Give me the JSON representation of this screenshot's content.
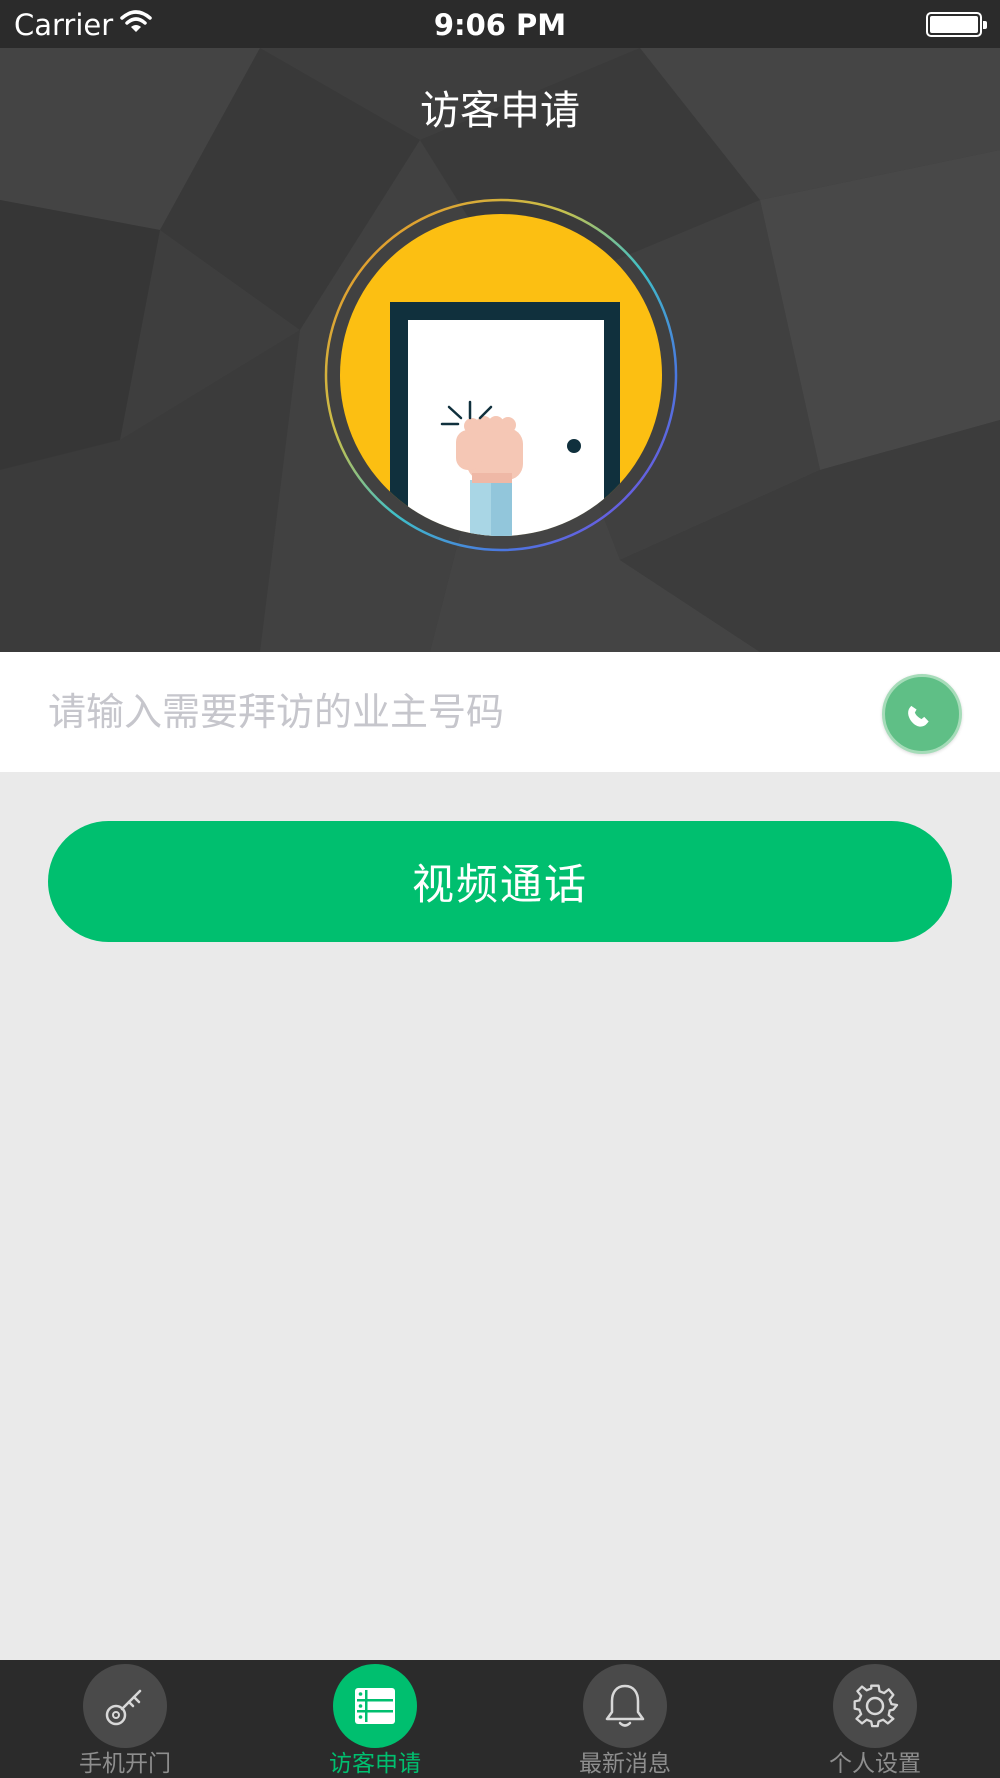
{
  "status_bar": {
    "carrier": "Carrier",
    "time": "9:06 PM"
  },
  "header": {
    "title": "访客申请"
  },
  "form": {
    "owner_number_placeholder": "请输入需要拜访的业主号码",
    "video_call_label": "视频通话"
  },
  "tabs": [
    {
      "label": "手机开门",
      "icon": "key-icon",
      "active": false
    },
    {
      "label": "访客申请",
      "icon": "list-icon",
      "active": true
    },
    {
      "label": "最新消息",
      "icon": "bell-icon",
      "active": false
    },
    {
      "label": "个人设置",
      "icon": "gear-icon",
      "active": false
    }
  ],
  "colors": {
    "accent": "#00bf6f",
    "header_bg": "#3f3f3f",
    "page_bg": "#eaeaea",
    "tabbar_bg": "#2b2b2b",
    "avatar_yellow": "#fcbf12"
  }
}
